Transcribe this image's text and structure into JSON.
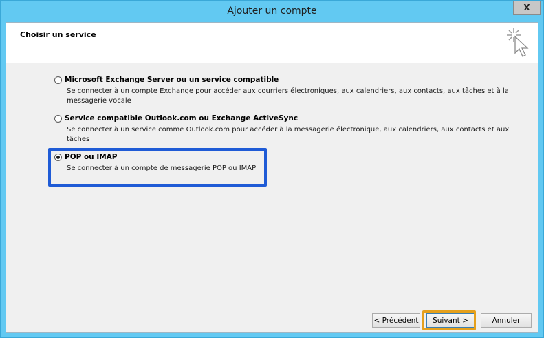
{
  "window": {
    "title": "Ajouter un compte",
    "close_glyph": "X"
  },
  "header": {
    "title": "Choisir un service",
    "icon": "wizard-cursor-icon"
  },
  "options": [
    {
      "label": "Microsoft Exchange Server ou un service compatible",
      "description": "Se connecter à un compte Exchange pour accéder aux courriers électroniques, aux calendriers, aux contacts, aux tâches et à la messagerie vocale",
      "selected": false
    },
    {
      "label": "Service compatible Outlook.com ou Exchange ActiveSync",
      "description": "Se connecter à un service comme Outlook.com pour accéder à la messagerie électronique, aux calendriers, aux contacts et aux tâches",
      "selected": false
    },
    {
      "label": "POP ou IMAP",
      "description": "Se connecter à un compte de messagerie POP ou IMAP",
      "selected": true
    }
  ],
  "buttons": {
    "previous": "< Précédent",
    "next": "Suivant >",
    "cancel": "Annuler"
  },
  "colors": {
    "titlebar": "#62c9f2",
    "selection_highlight": "#1f5bd6",
    "next_highlight": "#e5a01c"
  }
}
